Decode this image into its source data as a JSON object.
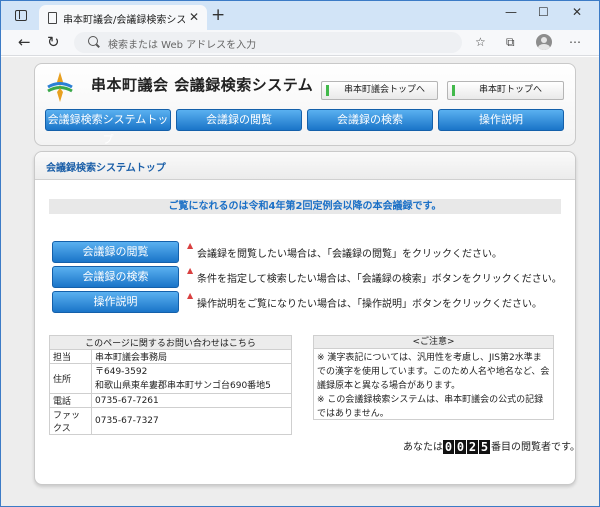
{
  "browser": {
    "tab_title": "串本町議会/会議録検索システム",
    "tab_close": "✕",
    "new_tab": "+",
    "address_placeholder": "検索または Web アドレスを入力",
    "window": {
      "minimize": "—",
      "maximize": "☐",
      "close": "✕"
    },
    "nav": {
      "back": "←",
      "reload": "↻"
    },
    "tools": {
      "favorites": "☆",
      "collections": "⧉",
      "menu": "⋯"
    }
  },
  "header": {
    "title": "串本町議会 会議録検索システム",
    "links": [
      {
        "label": "串本町議会トップへ"
      },
      {
        "label": "串本町トップへ"
      }
    ],
    "nav": [
      {
        "label": "会議録検索システムトップ"
      },
      {
        "label": "会議録の閲覧"
      },
      {
        "label": "会議録の検索"
      },
      {
        "label": "操作説明"
      }
    ]
  },
  "content": {
    "heading": "会議録検索システムトップ",
    "notice": "ご覧になれるのは令和4年第2回定例会以降の本会議録です。",
    "actions": [
      {
        "label": "会議録の閲覧",
        "desc": "会議録を閲覧したい場合は、「会議録の閲覧」をクリックください。"
      },
      {
        "label": "会議録の検索",
        "desc": "条件を指定して検索したい場合は、「会議録の検索」ボタンをクリックください。"
      },
      {
        "label": "操作説明",
        "desc": "操作説明をご覧になりたい場合は、「操作説明」ボタンをクリックください。"
      }
    ],
    "action_mark": "▲",
    "contact": {
      "heading": "このページに関するお問い合わせはこちら",
      "rows": [
        {
          "key": "担当",
          "value": "串本町議会事務局"
        },
        {
          "key": "住所",
          "value": "〒649-3592",
          "value2": "和歌山県東牟婁郡串本町サンゴ台690番地5"
        },
        {
          "key": "電話",
          "value": "0735-67-7261"
        },
        {
          "key": "ファックス",
          "value": "0735-67-7327"
        }
      ]
    },
    "caution": {
      "heading": "<ご注意>",
      "lines": [
        "※ 漢字表記については、汎用性を考慮し、JIS第2水準までの漢字を使用しています。このため人名や地名など、会議録原本と異なる場合があります。",
        "※ この会議録検索システムは、串本町議会の公式の記録ではありません。"
      ]
    },
    "counter": {
      "prefix": "あなたは",
      "digits": [
        "0",
        "0",
        "2",
        "5"
      ],
      "suffix": "番目の閲覧者です。"
    }
  },
  "colors": {
    "accent": "#1a74c8",
    "notice_text": "#1a6fc6",
    "heading_text": "#1b5fa8",
    "tab_strip": "#d2e4f7"
  }
}
